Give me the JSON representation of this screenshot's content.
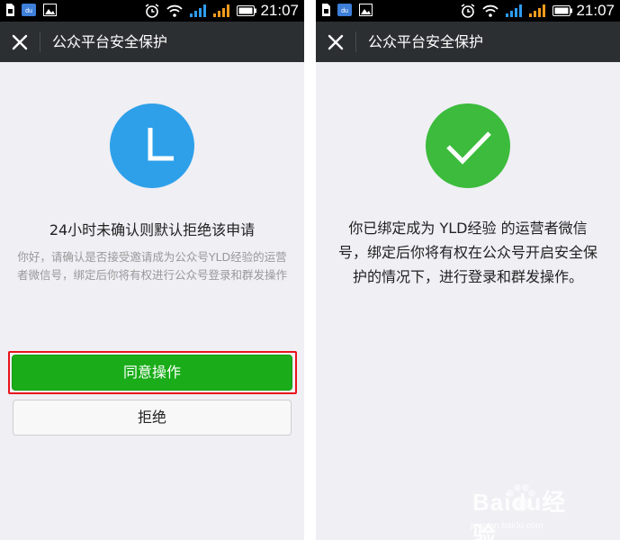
{
  "status_bar": {
    "time": "21:07",
    "icons": [
      "sim-card-icon",
      "app-notification-icon",
      "image-icon",
      "alarm-icon",
      "wifi-icon",
      "signal-icon-1",
      "signal-icon-2",
      "battery-icon"
    ]
  },
  "left_screen": {
    "nav_title": "公众平台安全保护",
    "status_icon": "clock-icon",
    "headline": "24小时未确认则默认拒绝该申请",
    "description": "你好，请确认是否接受邀请成为公众号YLD经验的运营者微信号，绑定后你将有权进行公众号登录和群发操作",
    "agree_label": "同意操作",
    "reject_label": "拒绝"
  },
  "right_screen": {
    "nav_title": "公众平台安全保护",
    "status_icon": "checkmark-icon",
    "message": "你已绑定成为 YLD经验 的运营者微信号，绑定后你将有权在公众号开启安全保护的情况下，进行登录和群发操作。"
  },
  "watermark": {
    "brand": "Baidu经验",
    "url": "jingyan.baidu.com"
  },
  "colors": {
    "navbar": "#2c2f32",
    "background": "#efeff4",
    "clock_blue": "#2ea0ea",
    "success_green": "#3cbb3c",
    "agree_button": "#1aad19",
    "highlight_red": "#e8141c"
  }
}
